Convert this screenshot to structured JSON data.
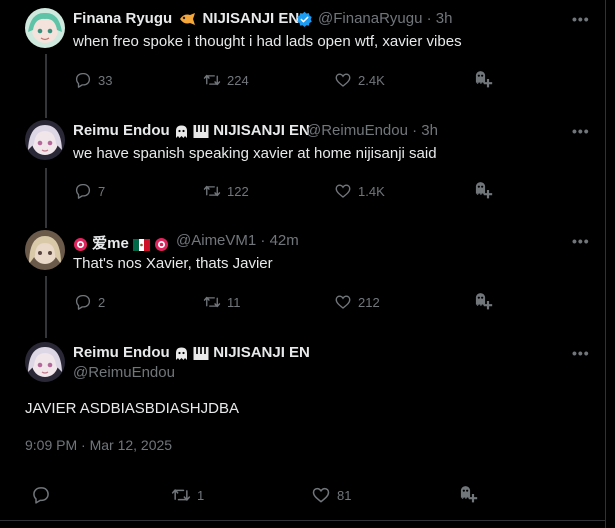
{
  "tweets": [
    {
      "display_name": "Finana Ryugu",
      "affiliation": "NIJISANJI EN",
      "handle": "@FinanaRyugu",
      "time": "3h",
      "text": "when freo spoke i thought i had lads open wtf, xavier vibes",
      "replies": "33",
      "retweets": "224",
      "likes": "2.4K"
    },
    {
      "display_name": "Reimu Endou",
      "affiliation": "NIJISANJI EN",
      "handle": "@ReimuEndou",
      "time": "3h",
      "text": "we have spanish speaking xavier at home nijisanji said",
      "replies": "7",
      "retweets": "122",
      "likes": "1.4K"
    },
    {
      "display_name": "爱me",
      "handle": "@AimeVM1",
      "time": "42m",
      "text": "That's nos Xavier, thats Javier",
      "replies": "2",
      "retweets": "11",
      "likes": "212"
    }
  ],
  "main_tweet": {
    "display_name": "Reimu Endou",
    "affiliation": "NIJISANJI EN",
    "handle": "@ReimuEndou",
    "text": "JAVIER ASDBIASBDIASHJDBA",
    "timestamp": "9:09 PM · Mar 12, 2025",
    "replies": "",
    "retweets": "1",
    "likes": "81"
  },
  "separator": "·",
  "more_label": "•••",
  "icons": {
    "reply": "reply-icon",
    "retweet": "retweet-icon",
    "like": "heart-icon",
    "grok": "grok-icon",
    "verified": "verified-badge-icon",
    "more": "more-options-icon"
  },
  "colors": {
    "background": "#000000",
    "text": "#e7e9ea",
    "secondary": "#71767b",
    "verified": "#1d9bf0",
    "thread_line": "#333639"
  }
}
